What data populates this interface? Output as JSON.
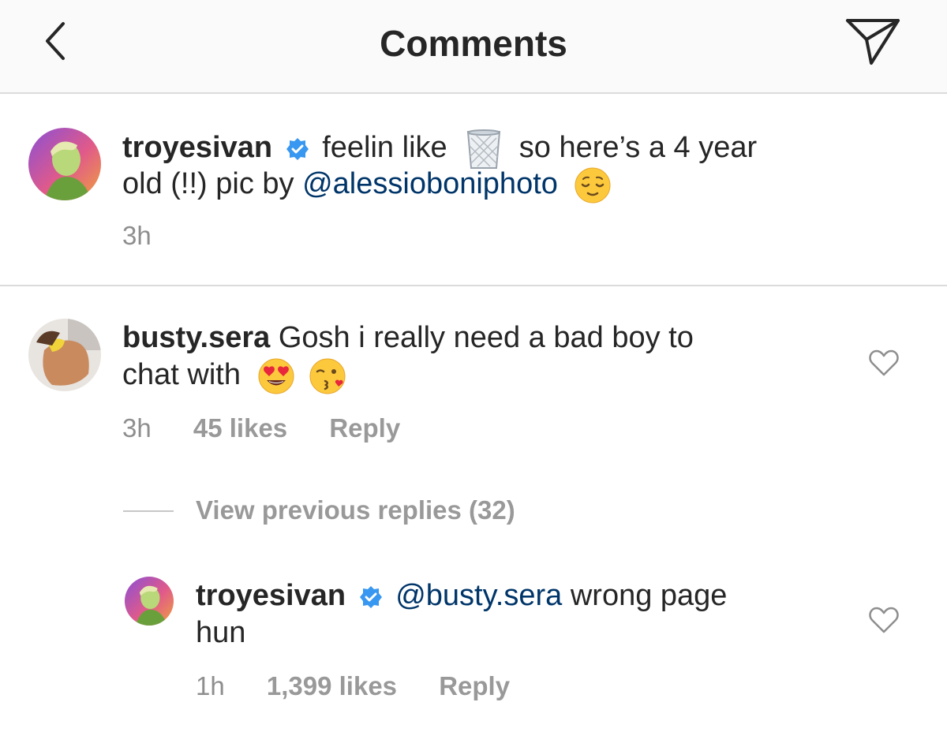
{
  "header": {
    "title": "Comments",
    "back_icon": "chevron-left-icon",
    "send_icon": "paper-plane-icon"
  },
  "caption": {
    "username": "troyesivan",
    "verified_icon": "verified-badge-icon",
    "text_part1": "feelin like",
    "emoji_1": "wastebasket-emoji",
    "text_part2": "so here’s a 4 year",
    "text_part3": "old (!!) pic by",
    "mention": "@alessioboniphoto",
    "emoji_2": "relieved-face-emoji",
    "time": "3h"
  },
  "comment": {
    "username": "busty.sera",
    "text_part1": "Gosh i really need a bad boy to",
    "text_part2": "chat with",
    "emojis": [
      "heart-eyes-emoji",
      "kissing-heart-emoji"
    ],
    "time": "3h",
    "likes": "45 likes",
    "reply_label": "Reply"
  },
  "view_replies": "View previous replies (32)",
  "reply": {
    "username": "troyesivan",
    "verified_icon": "verified-badge-icon",
    "mention": "@busty.sera",
    "text_part1": "wrong page",
    "text_part2": "hun",
    "time": "1h",
    "likes": "1,399 likes",
    "reply_label": "Reply"
  },
  "colors": {
    "text": "#262626",
    "meta": "#8e8e8e",
    "mention": "#003569",
    "verified": "#3897f0",
    "header_bg": "#fafafa",
    "divider": "#dbdbdb"
  }
}
